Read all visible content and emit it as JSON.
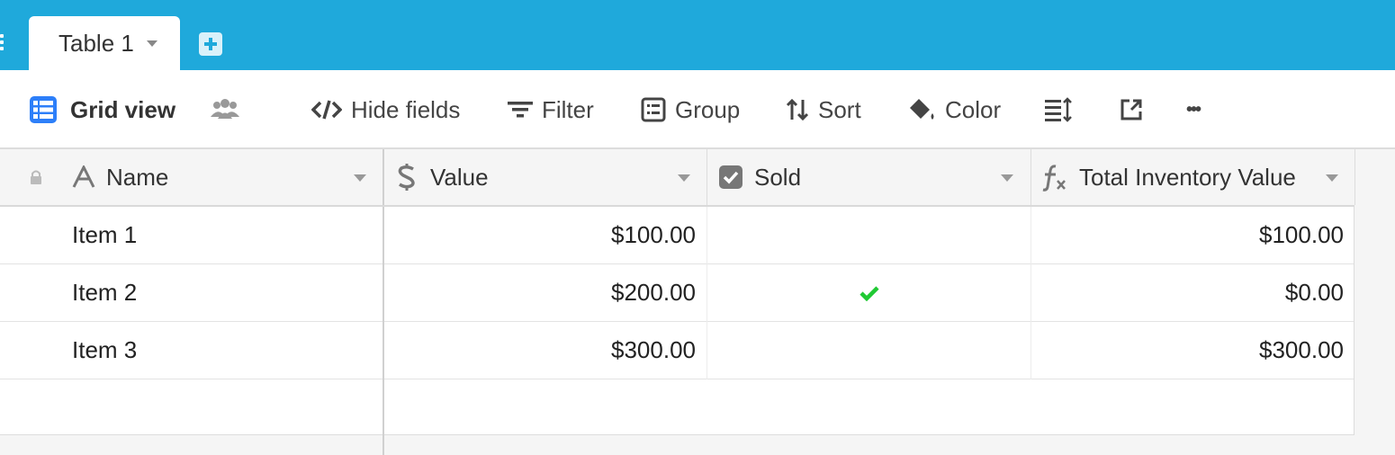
{
  "tabs": {
    "active": "Table 1"
  },
  "toolbar": {
    "view_name": "Grid view",
    "hide_fields": "Hide fields",
    "filter": "Filter",
    "group": "Group",
    "sort": "Sort",
    "color": "Color",
    "more": "•••"
  },
  "columns": [
    "Name",
    "Value",
    "Sold",
    "Total Inventory Value"
  ],
  "rows": [
    {
      "name": "Item 1",
      "value": "$100.00",
      "sold": false,
      "total": "$100.00"
    },
    {
      "name": "Item 2",
      "value": "$200.00",
      "sold": true,
      "total": "$0.00"
    },
    {
      "name": "Item 3",
      "value": "$300.00",
      "sold": false,
      "total": "$300.00"
    }
  ],
  "colors": {
    "topbar": "#1fa9db",
    "accent": "#2d7ff9",
    "check": "#20c933"
  }
}
